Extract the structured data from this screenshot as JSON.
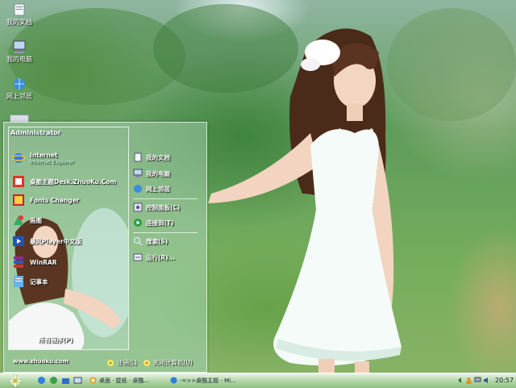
{
  "desktop": {
    "icons": [
      {
        "label": "我的文档",
        "icon": "my-documents-icon"
      },
      {
        "label": "我的电脑",
        "icon": "my-computer-icon"
      },
      {
        "label": "网上邻居",
        "icon": "network-places-icon"
      }
    ]
  },
  "start_menu": {
    "user_name": "Administrator",
    "pinned": [
      {
        "label": "Internet",
        "sub": "Internet Explorer",
        "icon": "internet-explorer-icon"
      },
      {
        "label": "桌酷主题Desk.ZhuoKu.Com",
        "icon": "zhuoku-theme-icon"
      },
      {
        "label": "Fonts Changer",
        "icon": "fonts-changer-icon"
      },
      {
        "label": "画图",
        "icon": "paint-icon"
      },
      {
        "label": "暴风Player中文版",
        "icon": "media-player-icon"
      },
      {
        "label": "WinRAR",
        "icon": "winrar-icon"
      },
      {
        "label": "记事本",
        "icon": "notepad-icon"
      }
    ],
    "all_programs": "所有程序(P)",
    "right": [
      {
        "label": "我的文档",
        "icon": "my-documents-icon"
      },
      {
        "label": "我的电脑",
        "icon": "my-computer-icon"
      },
      {
        "label": "网上邻居",
        "icon": "network-places-icon"
      },
      {
        "label": "控制面板(C)",
        "icon": "control-panel-icon"
      },
      {
        "label": "连接到(T)",
        "icon": "connect-to-icon"
      },
      {
        "label": "搜索(S)",
        "icon": "search-icon"
      },
      {
        "label": "运行(R)...",
        "icon": "run-icon"
      }
    ],
    "website": "www.zhuoku.com",
    "logoff": "注销(L)",
    "shutdown": "关闭计算机(U)"
  },
  "taskbar": {
    "tasks": [
      {
        "label": "桌面 · 壁纸 · 桌酷...",
        "icon": "browser-icon"
      },
      {
        "label": "-=>>桌酷主题 - Mi...",
        "icon": "ie-window-icon"
      }
    ],
    "clock": "20:57"
  },
  "colors": {
    "taskbar_top": "#eaf5e6",
    "taskbar_bottom": "#8fbf80",
    "menu_text": "#ffffff"
  }
}
